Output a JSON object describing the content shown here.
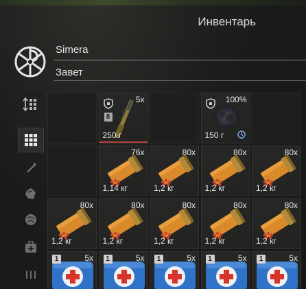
{
  "window": {
    "title": "Инвентарь"
  },
  "player": {
    "name": "Simera",
    "faction": "Завет",
    "faction_icon": "zavet-emblem-icon"
  },
  "sidebar": {
    "items": [
      {
        "name": "sort-icon",
        "active": false
      },
      {
        "name": "all-items-grid-icon",
        "active": true
      },
      {
        "name": "weapons-icon",
        "active": false
      },
      {
        "name": "armor-icon",
        "active": false
      },
      {
        "name": "artifacts-icon",
        "active": false
      },
      {
        "name": "medicine-icon",
        "active": false
      },
      {
        "name": "ammo-icon",
        "active": false
      }
    ]
  },
  "inventory": {
    "rows": [
      [
        {
          "type": "empty"
        },
        {
          "type": "rifle",
          "qty": "5x",
          "weight": "250 г",
          "level": "8",
          "protected": true,
          "selected": true
        },
        {
          "type": "empty"
        },
        {
          "type": "artifact",
          "qty": "100%",
          "weight": "150 г",
          "protected": true,
          "timed": true
        },
        {
          "type": "empty"
        }
      ],
      [
        {
          "type": "empty"
        },
        {
          "type": "shell",
          "qty": "76x",
          "weight": "1,14 кг"
        },
        {
          "type": "shell",
          "qty": "80x",
          "weight": "1,2 кг"
        },
        {
          "type": "shell",
          "qty": "80x",
          "weight": "1,2 кг"
        },
        {
          "type": "shell",
          "qty": "80x",
          "weight": "1,2 кг"
        }
      ],
      [
        {
          "type": "shell",
          "qty": "80x",
          "weight": "1,2 кг"
        },
        {
          "type": "shell",
          "qty": "80x",
          "weight": "1,2 кг"
        },
        {
          "type": "shell",
          "qty": "80x",
          "weight": "1,2 кг"
        },
        {
          "type": "shell",
          "qty": "80x",
          "weight": "1,2 кг"
        },
        {
          "type": "shell",
          "qty": "80x",
          "weight": "1,2 кг"
        }
      ],
      [
        {
          "type": "medkit",
          "qty": "5x",
          "badge": "1"
        },
        {
          "type": "medkit",
          "qty": "5x",
          "badge": "1"
        },
        {
          "type": "medkit",
          "qty": "5x",
          "badge": "1"
        },
        {
          "type": "medkit",
          "qty": "5x",
          "badge": "1"
        },
        {
          "type": "medkit",
          "qty": "5x",
          "badge": "1"
        }
      ]
    ]
  },
  "colors": {
    "selected_marker": "#b0453c",
    "shell_case": "#d98a2b",
    "medkit_blue": "#2f73c9",
    "medkit_cross": "#d9342b"
  }
}
